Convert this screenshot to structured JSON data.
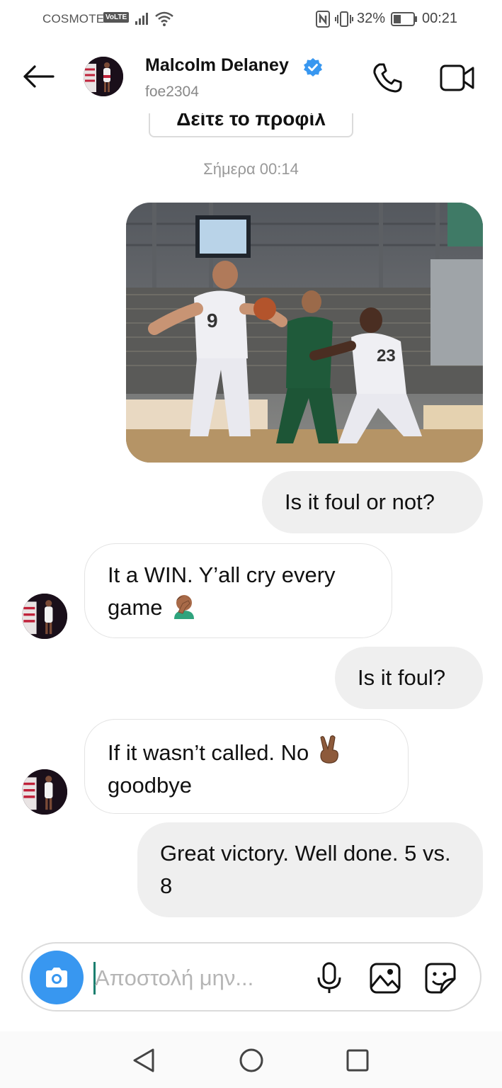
{
  "status_bar": {
    "carrier": "COSMOTE",
    "volte": "VoLTE",
    "battery_percent": "32%",
    "time": "00:21"
  },
  "header": {
    "contact_name": "Malcolm Delaney",
    "username": "foe2304",
    "verified": true,
    "icons": {
      "back": "arrow-left-icon",
      "call": "phone-icon",
      "video": "video-camera-icon"
    }
  },
  "profile_button_label": "Δείτε το προφίλ",
  "timestamp": "Σήμερα 00:14",
  "messages": [
    {
      "from": "me",
      "type": "photo"
    },
    {
      "from": "me",
      "text": "Is it foul or not?"
    },
    {
      "from": "contact",
      "text": "It a WIN. Y’all cry every game",
      "emoji": "face-palm (medium skin tone)"
    },
    {
      "from": "me",
      "text": "Is it foul?"
    },
    {
      "from": "contact",
      "text": "If it wasn’t called. No",
      "text_line2": "goodbye",
      "emoji": "victory-hand (medium-dark skin tone)"
    },
    {
      "from": "me",
      "text": "Great victory. Well done. 5 vs. 8"
    }
  ],
  "composer": {
    "placeholder": "Αποστολή μην...",
    "value": "",
    "icons": [
      "camera-icon",
      "microphone-icon",
      "gallery-icon",
      "sticker-icon"
    ]
  },
  "colors": {
    "accent": "#3897f0",
    "outgoing_bubble": "#efefef",
    "verified_badge": "#3897f0",
    "caret": "#1b7f6f"
  }
}
